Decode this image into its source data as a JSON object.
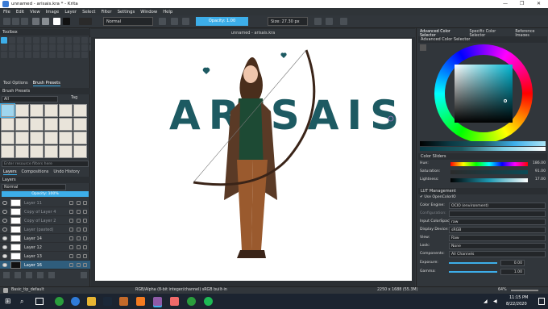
{
  "window": {
    "title": "unnamed - arisais.kra * - Krita",
    "controls": [
      "—",
      "❐",
      "✕"
    ]
  },
  "menu": [
    "File",
    "Edit",
    "View",
    "Image",
    "Layer",
    "Select",
    "Filter",
    "Settings",
    "Window",
    "Help"
  ],
  "toolbar": {
    "blend_mode": "Normal",
    "opacity_label": "Opacity:  1.00",
    "size_label": "Size:  27.30 px"
  },
  "left_panel": {
    "toolbox_title": "Toolbox",
    "tabs": [
      "Tool Options",
      "Brush Presets"
    ],
    "brush_presets_title": "Brush Presets",
    "brush_filter": "All",
    "brush_tag_label": "Tag",
    "brush_search_placeholder": "Enter resource filters here",
    "layer_tabs": [
      "Layers",
      "Compositions",
      "Undo History"
    ],
    "layers_title": "Layers",
    "layer_blend": "Normal",
    "layer_opacity": "Opacity:  100%",
    "layers": [
      {
        "name": "Layer 11",
        "visible": false
      },
      {
        "name": "Copy of Layer 4",
        "visible": false
      },
      {
        "name": "Copy of Layer 2",
        "visible": false
      },
      {
        "name": "Layer (pasted)",
        "visible": false
      },
      {
        "name": "Layer 14",
        "visible": true
      },
      {
        "name": "Layer 12",
        "visible": true
      },
      {
        "name": "Layer 13",
        "visible": true
      },
      {
        "name": "Layer 16",
        "visible": true
      }
    ]
  },
  "canvas": {
    "doc_tab": "unnamed - arisais.kra",
    "artwork_text": "ARISAIS"
  },
  "right_panel": {
    "tabs": [
      "Advanced Color Selector",
      "Specific Color Selector",
      "Reference Images"
    ],
    "color_selector_title": "Advanced Color Selector",
    "color_sliders_title": "Color Sliders",
    "sliders": [
      {
        "label": "Hue:",
        "value": "186.00"
      },
      {
        "label": "Saturation:",
        "value": "91.00"
      },
      {
        "label": "Lightness:",
        "value": "17.00"
      }
    ],
    "lut_title": "LUT Management",
    "use_ocio_label": "Use OpenColorIO",
    "lut_rows": [
      {
        "label": "Color Engine:",
        "value": "OCIO (environment)"
      },
      {
        "label": "Configuration:",
        "value": ""
      },
      {
        "label": "Input ColorSpace:",
        "value": "raw"
      },
      {
        "label": "Display Device:",
        "value": "sRGB"
      },
      {
        "label": "View:",
        "value": "Raw"
      },
      {
        "label": "Look:",
        "value": "None"
      },
      {
        "label": "Components:",
        "value": "All Channels"
      }
    ],
    "exposure_label": "Exposure:",
    "exposure_value": "0.00",
    "gamma_label": "Gamma:",
    "gamma_value": "1.00"
  },
  "statusbar": {
    "brush": "Basic_tip_default",
    "colorspace": "RGB/Alpha (8-bit integer/channel)  sRGB built-in",
    "dims": "2250 x 1688 (55.3M)",
    "zoom": "64%"
  },
  "taskbar": {
    "time": "11:15 PM",
    "date": "8/22/2020"
  },
  "colors": {
    "accent": "#3daee9",
    "panel": "#31363b",
    "teal_text": "#1d5a62"
  }
}
